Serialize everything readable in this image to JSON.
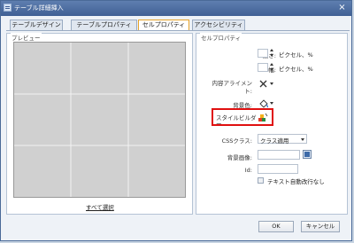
{
  "window": {
    "title": "テーブル詳細挿入",
    "close_glyph": "×"
  },
  "tabs": [
    {
      "label": "テーブルデザイン",
      "active": false
    },
    {
      "label": "テーブルプロパティ",
      "active": false
    },
    {
      "label": "セルプロパティ",
      "active": true
    },
    {
      "label": "アクセシビリティ",
      "active": false
    }
  ],
  "preview": {
    "title": "プレビュー",
    "select_all": "すべて選択"
  },
  "cell_props": {
    "title": "セルプロパティ",
    "height_label": "高さ:",
    "height_unit": "ピクセル、%",
    "width_label": "幅:",
    "width_unit": "ピクセル、%",
    "align_label_1": "内容アライメン",
    "align_label_2": "ト:",
    "bgcolor_label": "背景色:",
    "style_builder_label_1": "スタイルビルダ",
    "style_builder_label_2": "ー",
    "css_label": "CSSクラス:",
    "css_value": "クラス適用",
    "bgimage_label": "背景画像:",
    "id_label": "Id:",
    "nowrap_label": "テキスト自動改行なし",
    "nowrap_checked": false
  },
  "footer": {
    "ok_label": "OK",
    "cancel_label": "キャンセル"
  },
  "colors": {
    "title_bar": "#3f5f94",
    "active_tab_border": "#e5a32a",
    "highlight": "#e01010"
  }
}
